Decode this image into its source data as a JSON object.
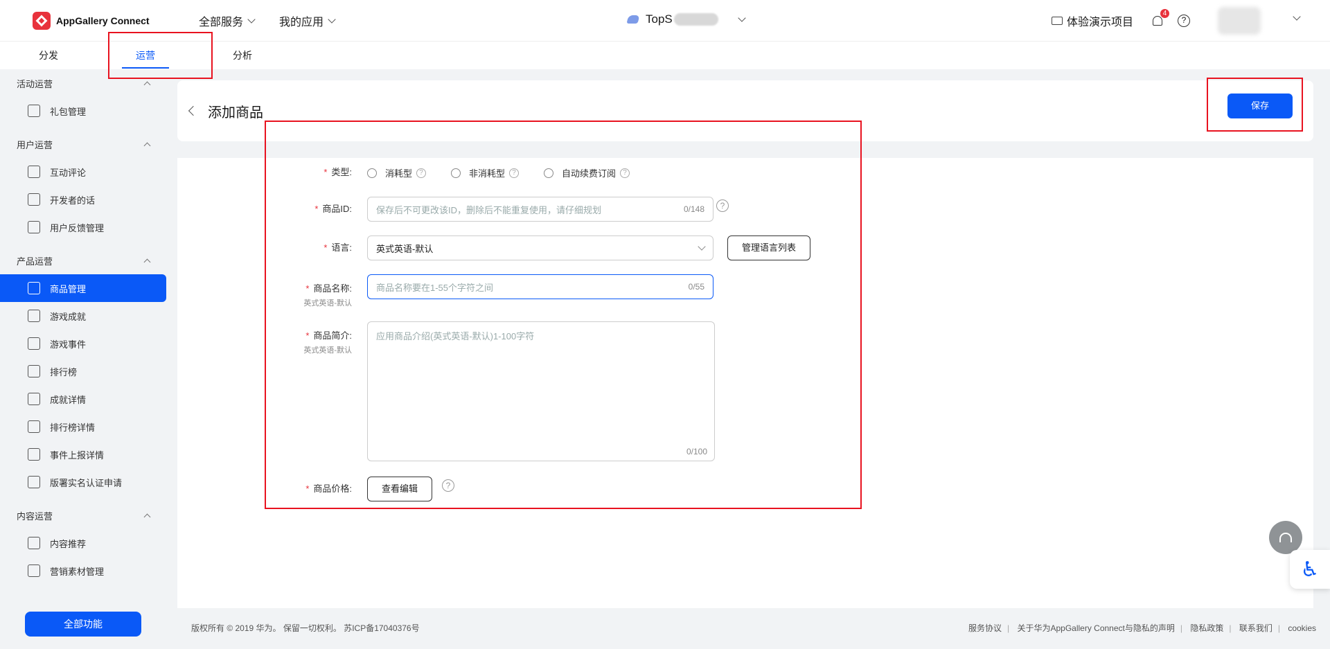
{
  "header": {
    "brand": "AppGallery Connect",
    "nav": [
      {
        "label": "全部服务"
      },
      {
        "label": "我的应用"
      }
    ],
    "app_name": "TopS",
    "demo_label": "体验演示项目",
    "notification_count": "4",
    "help_glyph": "?"
  },
  "subtabs": [
    {
      "label": "分发"
    },
    {
      "label": "运营"
    },
    {
      "label": "分析"
    }
  ],
  "sidebar": {
    "groups": [
      {
        "title": "活动运营",
        "items": [
          {
            "label": "礼包管理",
            "icon": "gift-icon"
          }
        ]
      },
      {
        "title": "用户运营",
        "items": [
          {
            "label": "互动评论",
            "icon": "comment-icon"
          },
          {
            "label": "开发者的话",
            "icon": "developer-note-icon"
          },
          {
            "label": "用户反馈管理",
            "icon": "feedback-icon"
          }
        ]
      },
      {
        "title": "产品运营",
        "items": [
          {
            "label": "商品管理",
            "icon": "bag-icon"
          },
          {
            "label": "游戏成就",
            "icon": "medal-icon"
          },
          {
            "label": "游戏事件",
            "icon": "event-icon"
          },
          {
            "label": "排行榜",
            "icon": "leaderboard-icon"
          },
          {
            "label": "成就详情",
            "icon": "achievement-detail-icon"
          },
          {
            "label": "排行榜详情",
            "icon": "leaderboard-detail-icon"
          },
          {
            "label": "事件上报详情",
            "icon": "event-report-icon"
          },
          {
            "label": "版署实名认证申请",
            "icon": "id-card-icon"
          }
        ]
      },
      {
        "title": "内容运营",
        "items": [
          {
            "label": "内容推荐",
            "icon": "recommend-icon"
          },
          {
            "label": "营销素材管理",
            "icon": "marketing-icon"
          }
        ]
      }
    ],
    "all_functions": "全部功能"
  },
  "page": {
    "title": "添加商品",
    "save": "保存"
  },
  "form": {
    "type_label": "类型:",
    "type_options": [
      "消耗型",
      "非消耗型",
      "自动续费订阅"
    ],
    "id_label": "商品ID:",
    "id_placeholder": "保存后不可更改该ID，删除后不能重复使用，请仔细规划",
    "id_count": "0/148",
    "lang_label": "语言:",
    "lang_value": "英式英语-默认",
    "manage_lang": "管理语言列表",
    "name_label": "商品名称:",
    "name_sub": "英式英语-默认",
    "name_placeholder": "商品名称要在1-55个字符之间",
    "name_count": "0/55",
    "desc_label": "商品简介:",
    "desc_sub": "英式英语-默认",
    "desc_placeholder": "应用商品介绍(英式英语-默认)1-100字符",
    "desc_count": "0/100",
    "price_label": "商品价格:",
    "price_btn": "查看编辑",
    "required_mark": "*"
  },
  "footer": {
    "copyright": "版权所有 © 2019 华为。 保留一切权利。 苏ICP备17040376号",
    "links": [
      "服务协议",
      "关于华为AppGallery Connect与隐私的声明",
      "隐私政策",
      "联系我们",
      "cookies"
    ]
  },
  "colors": {
    "primary": "#0a59f7",
    "brand_red": "#e8323c",
    "annotation": "#e8121f"
  }
}
